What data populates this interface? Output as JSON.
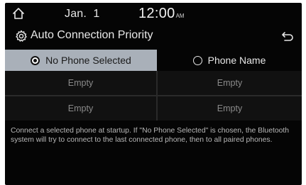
{
  "status_bar": {
    "date": "Jan.  1",
    "time": "12:00",
    "ampm": "AM"
  },
  "header": {
    "title": "Auto Connection Priority"
  },
  "options": [
    {
      "label": "No Phone Selected",
      "selected": true
    },
    {
      "label": "Phone Name",
      "selected": false
    }
  ],
  "slots": [
    [
      "Empty",
      "Empty"
    ],
    [
      "Empty",
      "Empty"
    ]
  ],
  "description": "Connect a selected phone at startup. If \"No Phone Selected\" is chosen, the Bluetooth system will try to connect to the last connected phone, then to all paired phones.",
  "icons": {
    "home": "home-icon",
    "settings": "gear-icon",
    "back": "back-arrow-icon"
  },
  "colors": {
    "screen_background": "#050505",
    "selected_option_background": "#a9b0b9",
    "slot_background": "#111111"
  }
}
